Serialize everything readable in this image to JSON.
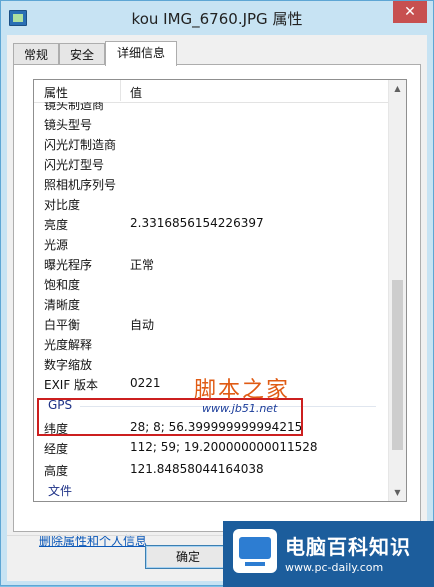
{
  "window": {
    "title": "kou  IMG_6760.JPG 属性",
    "close": "✕"
  },
  "tabs": [
    {
      "label": "常规",
      "active": false
    },
    {
      "label": "安全",
      "active": false
    },
    {
      "label": "详细信息",
      "active": true
    }
  ],
  "grid": {
    "col_property": "属性",
    "col_value": "值",
    "rows": [
      {
        "prop": "镜头制造商",
        "val": ""
      },
      {
        "prop": "镜头型号",
        "val": ""
      },
      {
        "prop": "闪光灯制造商",
        "val": ""
      },
      {
        "prop": "闪光灯型号",
        "val": ""
      },
      {
        "prop": "照相机序列号",
        "val": ""
      },
      {
        "prop": "对比度",
        "val": ""
      },
      {
        "prop": "亮度",
        "val": "2.3316856154226397"
      },
      {
        "prop": "光源",
        "val": ""
      },
      {
        "prop": "曝光程序",
        "val": "正常"
      },
      {
        "prop": "饱和度",
        "val": ""
      },
      {
        "prop": "清晰度",
        "val": ""
      },
      {
        "prop": "白平衡",
        "val": "自动"
      },
      {
        "prop": "光度解释",
        "val": ""
      },
      {
        "prop": "数字缩放",
        "val": ""
      },
      {
        "prop": "EXIF 版本",
        "val": "0221"
      }
    ],
    "gps_group": "GPS",
    "gps_rows": [
      {
        "prop": "纬度",
        "val": "28; 8; 56.399999999994215"
      },
      {
        "prop": "经度",
        "val": "112; 59; 19.200000000011528"
      },
      {
        "prop": "高度",
        "val": "121.84858044164038"
      }
    ],
    "file_group": "文件"
  },
  "links": {
    "remove": "删除属性和个人信息"
  },
  "buttons": {
    "ok": "确定"
  },
  "watermarks": {
    "jb51_cn": "脚本之家",
    "jb51_en": "www.jb51.net",
    "pcdaily_cn": "电脑百科知识",
    "pcdaily_en": "www.pc-daily.com"
  },
  "colors": {
    "highlight": "#cc1f1f",
    "link": "#0b58b8"
  }
}
